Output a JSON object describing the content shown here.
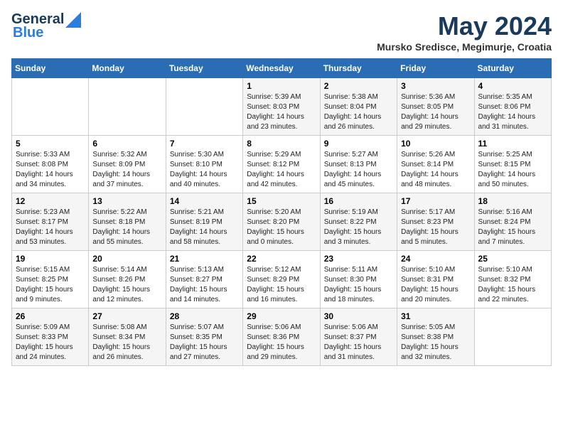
{
  "header": {
    "logo_line1": "General",
    "logo_line2": "Blue",
    "month_title": "May 2024",
    "location": "Mursko Sredisce, Megimurje, Croatia"
  },
  "days_of_week": [
    "Sunday",
    "Monday",
    "Tuesday",
    "Wednesday",
    "Thursday",
    "Friday",
    "Saturday"
  ],
  "weeks": [
    [
      {
        "num": "",
        "info": ""
      },
      {
        "num": "",
        "info": ""
      },
      {
        "num": "",
        "info": ""
      },
      {
        "num": "1",
        "info": "Sunrise: 5:39 AM\nSunset: 8:03 PM\nDaylight: 14 hours\nand 23 minutes."
      },
      {
        "num": "2",
        "info": "Sunrise: 5:38 AM\nSunset: 8:04 PM\nDaylight: 14 hours\nand 26 minutes."
      },
      {
        "num": "3",
        "info": "Sunrise: 5:36 AM\nSunset: 8:05 PM\nDaylight: 14 hours\nand 29 minutes."
      },
      {
        "num": "4",
        "info": "Sunrise: 5:35 AM\nSunset: 8:06 PM\nDaylight: 14 hours\nand 31 minutes."
      }
    ],
    [
      {
        "num": "5",
        "info": "Sunrise: 5:33 AM\nSunset: 8:08 PM\nDaylight: 14 hours\nand 34 minutes."
      },
      {
        "num": "6",
        "info": "Sunrise: 5:32 AM\nSunset: 8:09 PM\nDaylight: 14 hours\nand 37 minutes."
      },
      {
        "num": "7",
        "info": "Sunrise: 5:30 AM\nSunset: 8:10 PM\nDaylight: 14 hours\nand 40 minutes."
      },
      {
        "num": "8",
        "info": "Sunrise: 5:29 AM\nSunset: 8:12 PM\nDaylight: 14 hours\nand 42 minutes."
      },
      {
        "num": "9",
        "info": "Sunrise: 5:27 AM\nSunset: 8:13 PM\nDaylight: 14 hours\nand 45 minutes."
      },
      {
        "num": "10",
        "info": "Sunrise: 5:26 AM\nSunset: 8:14 PM\nDaylight: 14 hours\nand 48 minutes."
      },
      {
        "num": "11",
        "info": "Sunrise: 5:25 AM\nSunset: 8:15 PM\nDaylight: 14 hours\nand 50 minutes."
      }
    ],
    [
      {
        "num": "12",
        "info": "Sunrise: 5:23 AM\nSunset: 8:17 PM\nDaylight: 14 hours\nand 53 minutes."
      },
      {
        "num": "13",
        "info": "Sunrise: 5:22 AM\nSunset: 8:18 PM\nDaylight: 14 hours\nand 55 minutes."
      },
      {
        "num": "14",
        "info": "Sunrise: 5:21 AM\nSunset: 8:19 PM\nDaylight: 14 hours\nand 58 minutes."
      },
      {
        "num": "15",
        "info": "Sunrise: 5:20 AM\nSunset: 8:20 PM\nDaylight: 15 hours\nand 0 minutes."
      },
      {
        "num": "16",
        "info": "Sunrise: 5:19 AM\nSunset: 8:22 PM\nDaylight: 15 hours\nand 3 minutes."
      },
      {
        "num": "17",
        "info": "Sunrise: 5:17 AM\nSunset: 8:23 PM\nDaylight: 15 hours\nand 5 minutes."
      },
      {
        "num": "18",
        "info": "Sunrise: 5:16 AM\nSunset: 8:24 PM\nDaylight: 15 hours\nand 7 minutes."
      }
    ],
    [
      {
        "num": "19",
        "info": "Sunrise: 5:15 AM\nSunset: 8:25 PM\nDaylight: 15 hours\nand 9 minutes."
      },
      {
        "num": "20",
        "info": "Sunrise: 5:14 AM\nSunset: 8:26 PM\nDaylight: 15 hours\nand 12 minutes."
      },
      {
        "num": "21",
        "info": "Sunrise: 5:13 AM\nSunset: 8:27 PM\nDaylight: 15 hours\nand 14 minutes."
      },
      {
        "num": "22",
        "info": "Sunrise: 5:12 AM\nSunset: 8:29 PM\nDaylight: 15 hours\nand 16 minutes."
      },
      {
        "num": "23",
        "info": "Sunrise: 5:11 AM\nSunset: 8:30 PM\nDaylight: 15 hours\nand 18 minutes."
      },
      {
        "num": "24",
        "info": "Sunrise: 5:10 AM\nSunset: 8:31 PM\nDaylight: 15 hours\nand 20 minutes."
      },
      {
        "num": "25",
        "info": "Sunrise: 5:10 AM\nSunset: 8:32 PM\nDaylight: 15 hours\nand 22 minutes."
      }
    ],
    [
      {
        "num": "26",
        "info": "Sunrise: 5:09 AM\nSunset: 8:33 PM\nDaylight: 15 hours\nand 24 minutes."
      },
      {
        "num": "27",
        "info": "Sunrise: 5:08 AM\nSunset: 8:34 PM\nDaylight: 15 hours\nand 26 minutes."
      },
      {
        "num": "28",
        "info": "Sunrise: 5:07 AM\nSunset: 8:35 PM\nDaylight: 15 hours\nand 27 minutes."
      },
      {
        "num": "29",
        "info": "Sunrise: 5:06 AM\nSunset: 8:36 PM\nDaylight: 15 hours\nand 29 minutes."
      },
      {
        "num": "30",
        "info": "Sunrise: 5:06 AM\nSunset: 8:37 PM\nDaylight: 15 hours\nand 31 minutes."
      },
      {
        "num": "31",
        "info": "Sunrise: 5:05 AM\nSunset: 8:38 PM\nDaylight: 15 hours\nand 32 minutes."
      },
      {
        "num": "",
        "info": ""
      }
    ]
  ]
}
